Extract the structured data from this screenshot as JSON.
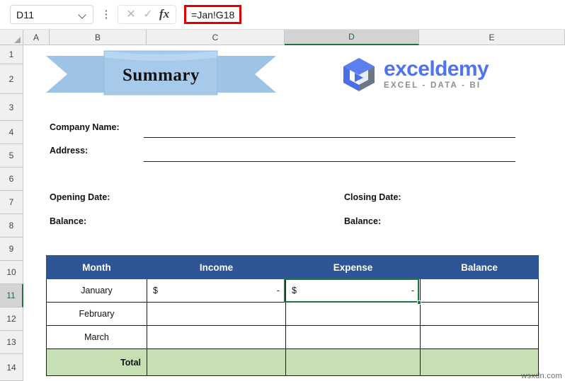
{
  "formula_bar": {
    "name_box_value": "D11",
    "name_box_icon": "chevron-down-icon",
    "menu_icon": "kebab-menu-icon",
    "cancel_icon": "✕",
    "confirm_icon": "✓",
    "fx_label": "fx",
    "formula_value": "=Jan!G18",
    "highlight_color": "#e00000"
  },
  "grid": {
    "columns": [
      "A",
      "B",
      "C",
      "D",
      "E"
    ],
    "selected_column": "D",
    "rows": [
      "1",
      "2",
      "3",
      "4",
      "5",
      "6",
      "7",
      "8",
      "9",
      "10",
      "11",
      "12",
      "13",
      "14"
    ],
    "selected_row": "11",
    "selection_color": "#217346"
  },
  "banner": {
    "title": "Summary",
    "ribbon_color": "#9dc3e6"
  },
  "logo": {
    "word": "exceldemy",
    "tagline": "EXCEL - DATA - BI",
    "word_color": "#4f74ef",
    "tagline_color": "#8d8d92"
  },
  "form": {
    "company_name_label": "Company Name:",
    "address_label": "Address:",
    "opening_date_label": "Opening Date:",
    "opening_balance_label": "Balance:",
    "closing_date_label": "Closing Date:",
    "closing_balance_label": "Balance:"
  },
  "table": {
    "headers": [
      "Month",
      "Income",
      "Expense",
      "Balance"
    ],
    "header_color": "#2e5596",
    "total_row_color": "#c6e0b4",
    "rows": [
      {
        "month": "January",
        "income_symbol": "$",
        "income_value": "-",
        "expense_symbol": "$",
        "expense_value": "-",
        "balance": ""
      },
      {
        "month": "February",
        "income_symbol": "",
        "income_value": "",
        "expense_symbol": "",
        "expense_value": "",
        "balance": ""
      },
      {
        "month": "March",
        "income_symbol": "",
        "income_value": "",
        "expense_symbol": "",
        "expense_value": "",
        "balance": ""
      }
    ],
    "total_label": "Total",
    "total_income": "",
    "total_expense": "",
    "total_balance": ""
  },
  "watermark": "wsxdn.com"
}
